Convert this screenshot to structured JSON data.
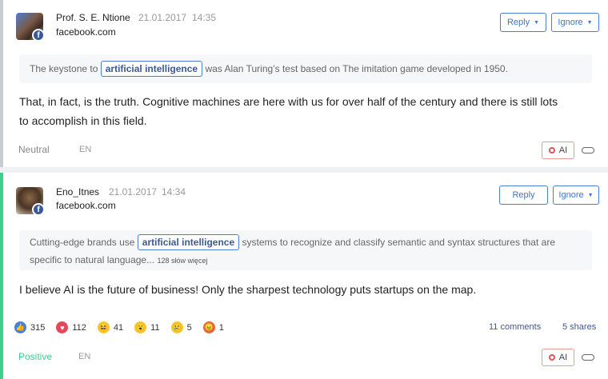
{
  "posts": [
    {
      "author": "Prof. S. E. Ntione",
      "date": "21.01.2017",
      "time": "14:35",
      "source": "facebook.com",
      "reply_label": "Reply",
      "ignore_label": "Ignore",
      "quote_before": "The keystone to",
      "quote_keyword": "artificial intelligence",
      "quote_after": "was Alan Turing’s test based on The imitation game developed in 1950.",
      "text": "That, in fact, is the truth. Cognitive machines are here with us for over half of the century and there is still lots to accomplish in this field.",
      "sentiment": "Neutral",
      "language": "EN",
      "ai_label": "AI"
    },
    {
      "author": "Eno_Itnes",
      "date": "21.01.2017",
      "time": "14:34",
      "source": "facebook.com",
      "reply_label": "Reply",
      "ignore_label": "Ignore",
      "quote_before": "Cutting-edge brands use",
      "quote_keyword": "artificial intelligence",
      "quote_after": "systems to recognize and classify semantic and syntax structures that are specific to natural language...",
      "quote_more": "128 słów więcej",
      "text": "I believe AI is the future of business! Only the sharpest technology puts startups on the map.",
      "reactions": [
        {
          "icon": "like-icon",
          "color": "#4a7fd8",
          "count": "315"
        },
        {
          "icon": "love-icon",
          "color": "#e5485a",
          "count": "112"
        },
        {
          "icon": "haha-icon",
          "color": "#f7c52b",
          "count": "41"
        },
        {
          "icon": "wow-icon",
          "color": "#f7c52b",
          "count": "11"
        },
        {
          "icon": "sad-icon",
          "color": "#f7c52b",
          "count": "5"
        },
        {
          "icon": "angry-icon",
          "color": "#e8643c",
          "count": "1"
        }
      ],
      "comments": "11 comments",
      "shares": "5 shares",
      "sentiment": "Positive",
      "sentiment_color": "#3ecf8e",
      "language": "EN",
      "ai_label": "AI"
    }
  ]
}
